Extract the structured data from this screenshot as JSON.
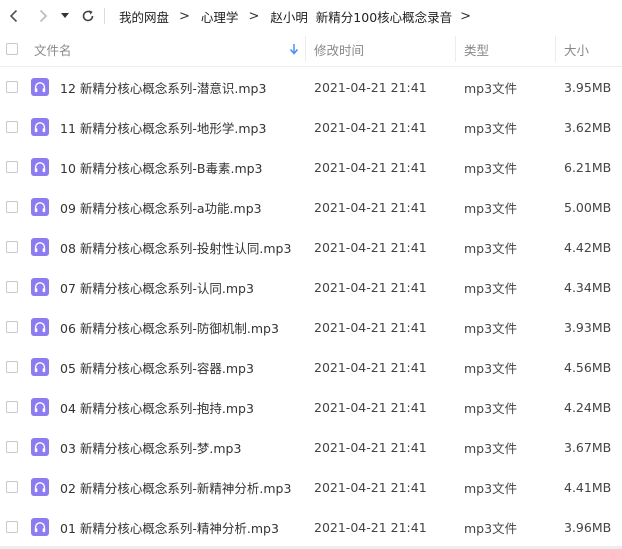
{
  "breadcrumb": [
    "我的网盘",
    "心理学",
    "赵小明  新精分100核心概念录音"
  ],
  "breadcrumb_separator": ">",
  "columns": {
    "name": "文件名",
    "modified": "修改时间",
    "type": "类型",
    "size": "大小"
  },
  "colors": {
    "icon": "#8c7cf0",
    "accent": "#3b8cf2"
  },
  "files": [
    {
      "name": "12 新精分核心概念系列-潜意识.mp3",
      "modified": "2021-04-21 21:41",
      "type": "mp3文件",
      "size": "3.95MB"
    },
    {
      "name": "11 新精分核心概念系列-地形学.mp3",
      "modified": "2021-04-21 21:41",
      "type": "mp3文件",
      "size": "3.62MB"
    },
    {
      "name": "10 新精分核心概念系列-B毒素.mp3",
      "modified": "2021-04-21 21:41",
      "type": "mp3文件",
      "size": "6.21MB"
    },
    {
      "name": "09 新精分核心概念系列-a功能.mp3",
      "modified": "2021-04-21 21:41",
      "type": "mp3文件",
      "size": "5.00MB"
    },
    {
      "name": "08 新精分核心概念系列-投射性认同.mp3",
      "modified": "2021-04-21 21:41",
      "type": "mp3文件",
      "size": "4.42MB"
    },
    {
      "name": "07 新精分核心概念系列-认同.mp3",
      "modified": "2021-04-21 21:41",
      "type": "mp3文件",
      "size": "4.34MB"
    },
    {
      "name": "06 新精分核心概念系列-防御机制.mp3",
      "modified": "2021-04-21 21:41",
      "type": "mp3文件",
      "size": "3.93MB"
    },
    {
      "name": "05 新精分核心概念系列-容器.mp3",
      "modified": "2021-04-21 21:41",
      "type": "mp3文件",
      "size": "4.56MB"
    },
    {
      "name": "04 新精分核心概念系列-抱持.mp3",
      "modified": "2021-04-21 21:41",
      "type": "mp3文件",
      "size": "4.24MB"
    },
    {
      "name": "03 新精分核心概念系列-梦.mp3",
      "modified": "2021-04-21 21:41",
      "type": "mp3文件",
      "size": "3.67MB"
    },
    {
      "name": "02 新精分核心概念系列-新精神分析.mp3",
      "modified": "2021-04-21 21:41",
      "type": "mp3文件",
      "size": "4.41MB"
    },
    {
      "name": "01 新精分核心概念系列-精神分析.mp3",
      "modified": "2021-04-21 21:41",
      "type": "mp3文件",
      "size": "3.96MB"
    }
  ]
}
